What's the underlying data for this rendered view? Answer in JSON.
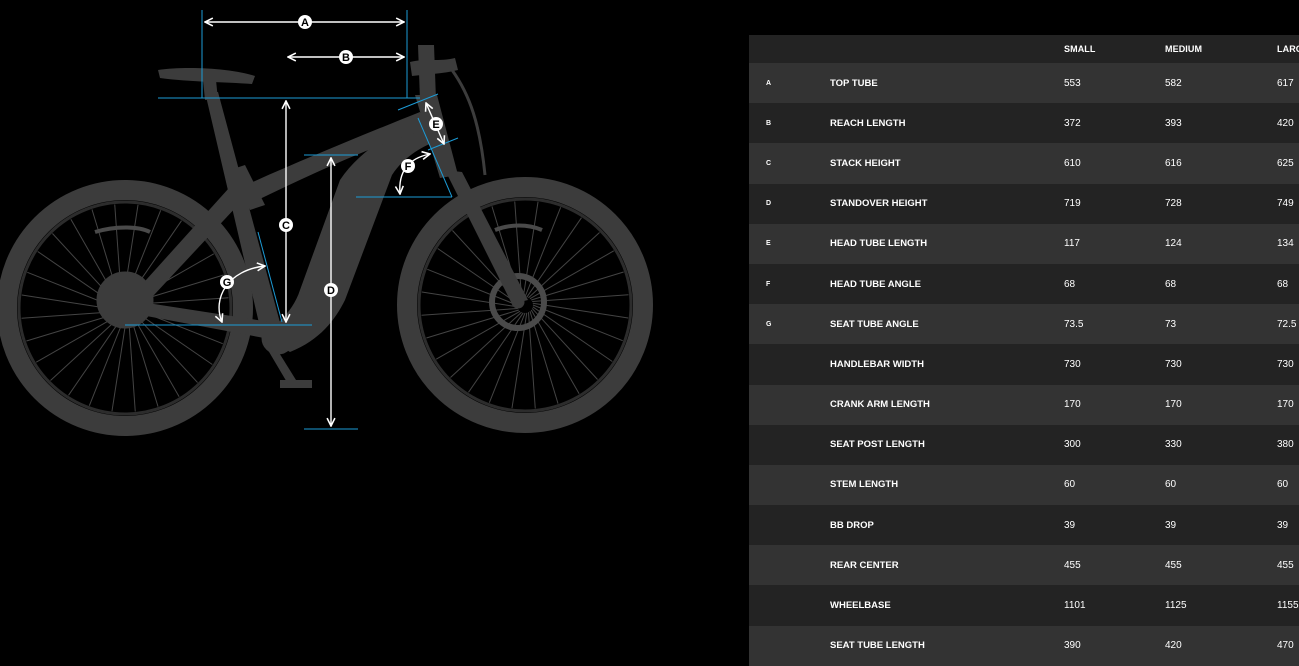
{
  "diagram": {
    "labels": [
      "A",
      "B",
      "C",
      "D",
      "E",
      "F",
      "G"
    ],
    "colors": {
      "bike": "#3c3c3c",
      "measure_line": "#ffffff",
      "reference_line": "#1c9bd6"
    }
  },
  "geometry": {
    "columns": [
      "SMALL",
      "MEDIUM",
      "LARGE"
    ],
    "rows": [
      {
        "letter": "A",
        "name": "TOP TUBE",
        "small": "553",
        "medium": "582",
        "large": "617"
      },
      {
        "letter": "B",
        "name": "REACH LENGTH",
        "small": "372",
        "medium": "393",
        "large": "420"
      },
      {
        "letter": "C",
        "name": "STACK HEIGHT",
        "small": "610",
        "medium": "616",
        "large": "625"
      },
      {
        "letter": "D",
        "name": "STANDOVER HEIGHT",
        "small": "719",
        "medium": "728",
        "large": "749"
      },
      {
        "letter": "E",
        "name": "HEAD TUBE LENGTH",
        "small": "117",
        "medium": "124",
        "large": "134"
      },
      {
        "letter": "F",
        "name": "HEAD TUBE ANGLE",
        "small": "68",
        "medium": "68",
        "large": "68"
      },
      {
        "letter": "G",
        "name": "SEAT TUBE ANGLE",
        "small": "73.5",
        "medium": "73",
        "large": "72.5"
      },
      {
        "letter": "",
        "name": "HANDLEBAR WIDTH",
        "small": "730",
        "medium": "730",
        "large": "730"
      },
      {
        "letter": "",
        "name": "CRANK ARM LENGTH",
        "small": "170",
        "medium": "170",
        "large": "170"
      },
      {
        "letter": "",
        "name": "SEAT POST LENGTH",
        "small": "300",
        "medium": "330",
        "large": "380"
      },
      {
        "letter": "",
        "name": "STEM LENGTH",
        "small": "60",
        "medium": "60",
        "large": "60"
      },
      {
        "letter": "",
        "name": "BB DROP",
        "small": "39",
        "medium": "39",
        "large": "39"
      },
      {
        "letter": "",
        "name": "REAR CENTER",
        "small": "455",
        "medium": "455",
        "large": "455"
      },
      {
        "letter": "",
        "name": "WHEELBASE",
        "small": "1101",
        "medium": "1125",
        "large": "1155"
      },
      {
        "letter": "",
        "name": "SEAT TUBE LENGTH",
        "small": "390",
        "medium": "420",
        "large": "470"
      }
    ]
  }
}
